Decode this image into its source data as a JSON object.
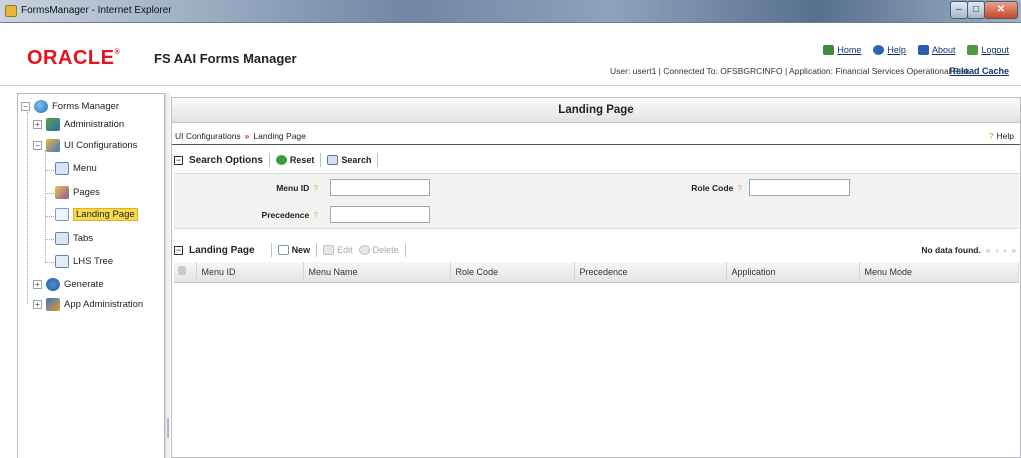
{
  "window": {
    "title": "FormsManager - Internet Explorer",
    "controls": {
      "minimize": "–",
      "maximize": "□",
      "close": "✕"
    }
  },
  "header": {
    "logo": "ORACLE",
    "logo_mark": "®",
    "product": "FS AAI Forms Manager",
    "links": {
      "home": "Home",
      "help": "Help",
      "about": "About",
      "logout": "Logout"
    },
    "user_info": "User: usert1  |  Connected To: OFSBGRCINFO  |  Application: Financial Services Operational Risk",
    "reload": "Reload Cache"
  },
  "tree": {
    "root": "Forms Manager",
    "items": [
      {
        "label": "Administration",
        "icon": "admin-icon"
      },
      {
        "label": "UI Configurations",
        "icon": "ui-config-icon"
      },
      {
        "label": "Menu",
        "icon": "menu-icon"
      },
      {
        "label": "Pages",
        "icon": "pages-icon"
      },
      {
        "label": "Landing Page",
        "icon": "landing-page-icon"
      },
      {
        "label": "Tabs",
        "icon": "tabs-icon"
      },
      {
        "label": "LHS Tree",
        "icon": "lhs-tree-icon"
      },
      {
        "label": "Generate",
        "icon": "generate-icon"
      },
      {
        "label": "App Administration",
        "icon": "app-admin-icon"
      }
    ],
    "selected": "Landing Page"
  },
  "panel": {
    "title": "Landing Page",
    "breadcrumb": {
      "parent": "UI Configurations",
      "separator": "»",
      "current": "Landing Page"
    },
    "help": "Help",
    "search": {
      "title": "Search Options",
      "reset": "Reset",
      "search": "Search",
      "menu_id_label": "Menu ID",
      "role_code_label": "Role Code",
      "precedence_label": "Precedence",
      "menu_id_value": "",
      "role_code_value": "",
      "precedence_value": ""
    },
    "list": {
      "title": "Landing Page",
      "new": "New",
      "edit": "Edit",
      "delete": "Delete",
      "status": "No data found.",
      "pager": {
        "first": "«",
        "prev": "‹",
        "next": "›",
        "last": "»"
      },
      "columns": [
        "Menu ID",
        "Menu Name",
        "Role Code",
        "Precedence",
        "Application",
        "Menu Mode"
      ]
    }
  },
  "colors": {
    "brand": "#e3141b",
    "link": "#11336b",
    "selected": "#f7d94c",
    "breadcrumb_sep": "#c62c1d"
  }
}
